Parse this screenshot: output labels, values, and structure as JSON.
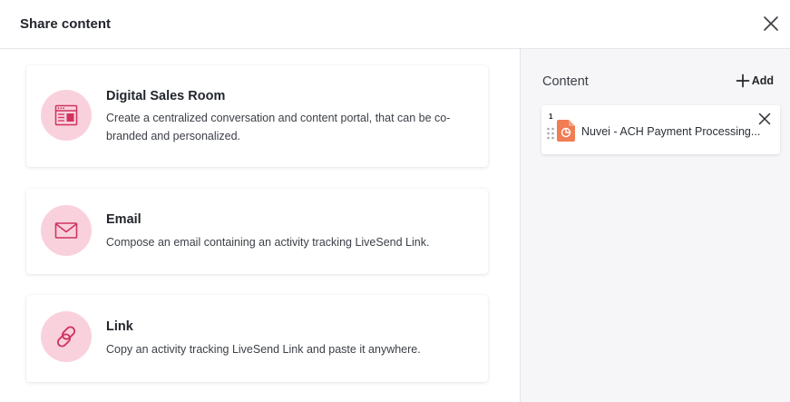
{
  "dialog": {
    "title": "Share content"
  },
  "options": [
    {
      "title": "Digital Sales Room",
      "description": "Create a centralized conversation and content portal, that can be co-branded and personalized.",
      "icon": "browser-window-icon"
    },
    {
      "title": "Email",
      "description": "Compose an email containing an activity tracking LiveSend Link.",
      "icon": "envelope-icon"
    },
    {
      "title": "Link",
      "description": "Copy an activity tracking LiveSend Link and paste it anywhere.",
      "icon": "chain-link-icon"
    }
  ],
  "content_panel": {
    "label": "Content",
    "add_label": "Add",
    "items": [
      {
        "index": "1",
        "name": "Nuvei - ACH Payment Processing...",
        "file_icon": "presentation-file-icon"
      }
    ]
  },
  "colors": {
    "accent": "#d0335f",
    "icon_circle": "#f9d1dc",
    "file_orange": "#f07d53",
    "panel_bg": "#f6f6f8"
  }
}
